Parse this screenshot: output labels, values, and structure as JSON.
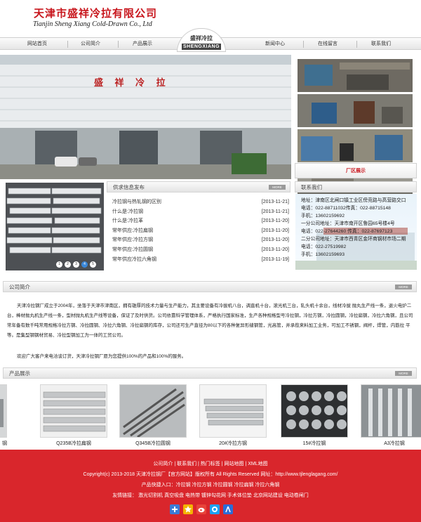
{
  "header": {
    "company_cn": "天津市盛祥冷拉有限公司",
    "company_en": "Tianjin Sheng Xiang  Cold-Drawn Co., Ltd"
  },
  "nav": {
    "items": [
      "网站首页",
      "公司简介",
      "产品展示",
      "新闻中心",
      "在线留言",
      "联系我们"
    ],
    "center_cn": "盛祥冷拉",
    "center_en": "SHENGXIANG"
  },
  "banner": {
    "sign_text": "盛 祥 冷 拉"
  },
  "products_tab": "厂区展示",
  "slider": {
    "dots": [
      "1",
      "2",
      "3",
      "4",
      "5"
    ],
    "active": 4
  },
  "news": {
    "title": "供求信息发布",
    "more": "MORE",
    "items": [
      {
        "title": "冷拉钢与热轧钢的区别",
        "date": "[2013-11-21]"
      },
      {
        "title": "什么是:冷拉钢",
        "date": "[2013-11-21]"
      },
      {
        "title": "什么是:冷拉革",
        "date": "[2013-11-20]"
      },
      {
        "title": "常年供应:冷拉扁钢",
        "date": "[2013-11-20]"
      },
      {
        "title": "常年供应:冷拉方钢",
        "date": "[2013-11-20]"
      },
      {
        "title": "常年供应:冷拉圆钢",
        "date": "[2013-11-20]"
      },
      {
        "title": "常年供应冷拉六角钢",
        "date": "[2013-11-19]"
      }
    ]
  },
  "contact": {
    "title": "联系我们",
    "lines": [
      "地址：津南区北闸口镇工业区傍竞路与高营路交口",
      "电话：022-88711032传真：022-88715148",
      "手机：13602159692",
      "一分公司地址：天津市南开区鲁园65号楼4号",
      "电话：022-27644260 传真：022-87697123",
      "二分公司地址：天津市西青区金环商钢材市场二期",
      "电话：022-27519982",
      "手机：13602159693"
    ]
  },
  "intro": {
    "title": "公司简介",
    "more": "MORE",
    "p1": "天津冷拉钢厂成立于2004年，坐落于天津市津南区，拥有雄厚的技术力量与生产能力，其主要设备有冷拔机八台，调直机十台，滚光机三台，轧头机十余台，线材冷拔 抛丸生产线一条，退火电炉二台，棒材抛丸机生产线一条，型材抛丸机生产线等设备，保证了及时供货。公司依靠科学管理体系，严格执行国家标准，生产各种规格型号冷拉钢，冷拉方钢，冷拉圆钢，冷拉扁钢，冷拉六角钢，且公司常年备有数千吨常用规格冷拉方钢、冷拉圆钢、冷拉六角钢、冷拉扁钢的库存，公司还可生产直径为80以下的各种复异形缝钢管，光高管，并承揽来料加工业务，可加工不锈钢，阀杆，焊管，内筋拉 平等。是集型钢钢材贸易、冷拉型钢加工为一体的工贸公司。",
    "p2": "欢迎广大客户来电洽谈订货，天津冷拉钢厂愿为您提供100%的产品和100%的服务。"
  },
  "products": {
    "title": "产品展示",
    "more": "MORE",
    "items": [
      {
        "caption": "钢"
      },
      {
        "caption": "Q235B冷拉扁钢"
      },
      {
        "caption": "Q345B冷拉圆钢"
      },
      {
        "caption": "20#冷拉方钢"
      },
      {
        "caption": "15#冷拉钢"
      },
      {
        "caption": "A3冷拉钢"
      }
    ]
  },
  "footer": {
    "links": "公司简介  |  联系我们  |  热门标签  |  网站地图  |  XML地图",
    "copyright": "Copyright(c) 2013-2018 天津冷拉钢厂【官方网站】版权所有 All Rights Reserved   网址：http://www.tjlenglagang.com/",
    "quick": "产品快捷入口：冷拉钢   冷拉方钢   冷拉圆钢   冷拉扁钢   冷拉六角钢",
    "friends": "友情链接：  激光切割机   真空吸盘   电热带   镀锌勾花网   手术体位垫   北京网站建设   电动卷闸门"
  },
  "colors": {
    "brand_red": "#c8161d",
    "footer_red": "#d9262c"
  }
}
